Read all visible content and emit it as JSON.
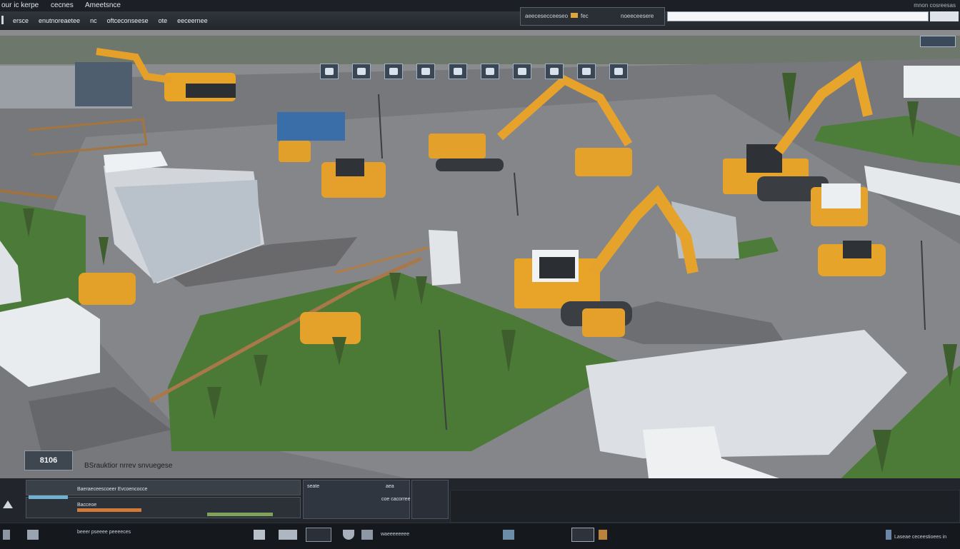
{
  "window": {
    "title_parts": [
      "our ic kerpe",
      "cecnes",
      "Ameetsnce"
    ],
    "right_label": "mnon cosreesas"
  },
  "menu": {
    "items": [
      "ersce",
      "enutnoreaetee",
      "nc",
      "oftceconseese",
      "ote",
      "eeceernee"
    ],
    "search_label": "aeecesecceeseo",
    "search_badge": "fec",
    "search_right": "noeeceesere"
  },
  "overlay": {
    "badge": "8106",
    "status": "BSrauktior nrrev snvuegese"
  },
  "bottom_panel": {
    "row1_label": "Baeraeceescoeer Evcoencocce",
    "row2_label": "Bacceoe",
    "middle_label": "seate",
    "right_label_a": "aea",
    "right_label_b": "coe cacorree"
  },
  "taskbar": {
    "left_label": "beeer pseeee peeeeces",
    "mid_label": "waeeeeeeee",
    "right_label": "Laseae ceceestioees in"
  },
  "colors": {
    "accent_yellow": "#e8a427",
    "grass": "#4c7a38",
    "ground": "#76777a",
    "panel": "#22262c"
  },
  "icons": {
    "toolbar": [
      "select-icon",
      "move-icon",
      "rotate-icon",
      "scale-icon",
      "camera-icon",
      "render-icon",
      "layers-icon",
      "light-icon",
      "material-icon",
      "grid-icon"
    ],
    "taskbar": [
      "home-icon",
      "vehicle-icon",
      "monitor-icon",
      "shield-icon",
      "settings-icon",
      "info-icon"
    ]
  }
}
